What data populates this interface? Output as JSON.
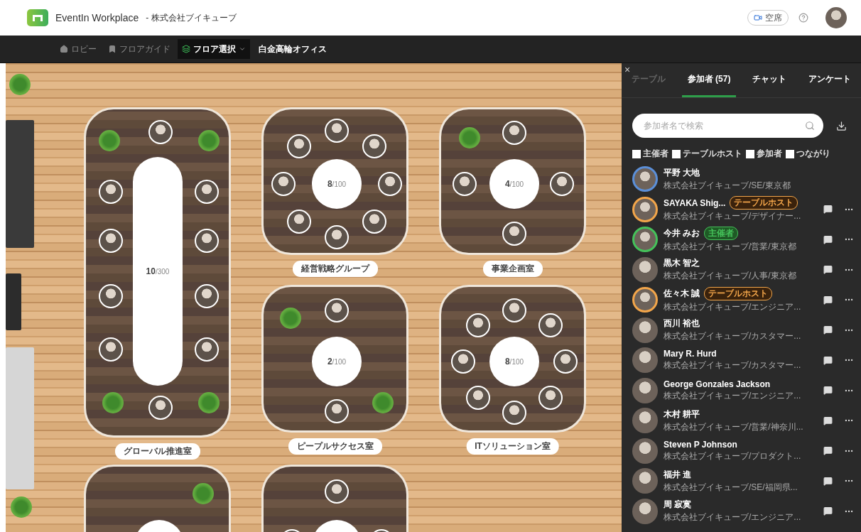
{
  "header": {
    "app_name": "EventIn Workplace",
    "org": "- 株式会社ブイキューブ",
    "status_button": "空席"
  },
  "nav": [
    {
      "kind": "home",
      "label": "ロビー",
      "selected": false
    },
    {
      "kind": "guide",
      "label": "フロアガイド",
      "selected": false
    },
    {
      "kind": "floor",
      "label": "フロア選択",
      "selected": true
    }
  ],
  "current_floor": "白金高輪オフィス",
  "rooms": [
    {
      "kind": "long",
      "label": "グローバル推進室",
      "count": "**10**/300"
    },
    {
      "kind": "round",
      "label": "経営戦略グループ",
      "count": "**8**/100"
    },
    {
      "kind": "round",
      "label": "事業企画室",
      "count": "**4**/100"
    },
    {
      "kind": "round",
      "label": "ピープルサクセス室",
      "count": "**2**/100"
    },
    {
      "kind": "round",
      "label": "ITソリューション室",
      "count": "**8**/100"
    },
    {
      "kind": "round"
    },
    {
      "kind": "round"
    }
  ],
  "panel": {
    "close": "×",
    "tabs": [
      {
        "label": "テーブル",
        "selected": false
      },
      {
        "label": "参加者 (57)",
        "selected": true
      },
      {
        "label": "チャット",
        "selected": false
      },
      {
        "label": "アンケート",
        "selected": false
      }
    ],
    "search": {
      "placeholder": "参加者名で検索"
    },
    "filters": [
      {
        "label": "主催者",
        "checked": false
      },
      {
        "label": "テーブルホスト",
        "checked": false
      },
      {
        "label": "参加者",
        "checked": false
      },
      {
        "label": "つながり",
        "checked": false
      }
    ],
    "participants": [
      {
        "name": "平野 大地",
        "detail": "株式会社ブイキューブ/SE/東京都",
        "self": true
      },
      {
        "name": "SAYAKA Shig...",
        "detail": "株式会社ブイキューブ/デザイナー...",
        "self": false,
        "badge": {
          "kind": "host",
          "label": "テーブルホスト"
        }
      },
      {
        "name": "今井 みお",
        "detail": "株式会社ブイキューブ/営業/東京都",
        "self": false,
        "badge": {
          "kind": "organizer",
          "label": "主催者"
        }
      },
      {
        "name": "黒木 智之",
        "detail": "株式会社ブイキューブ/人事/東京都",
        "self": false
      },
      {
        "name": "佐々木 誠",
        "detail": "株式会社ブイキューブ/エンジニア...",
        "self": false,
        "badge": {
          "kind": "host",
          "label": "テーブルホスト"
        }
      },
      {
        "name": "西川 裕也",
        "detail": "株式会社ブイキューブ/カスタマー...",
        "self": false
      },
      {
        "name": "Mary R. Hurd",
        "detail": "株式会社ブイキューブ/カスタマー...",
        "self": false
      },
      {
        "name": "George Gonzales Jackson",
        "detail": "株式会社ブイキューブ/エンジニア...",
        "self": false
      },
      {
        "name": "木村 耕平",
        "detail": "株式会社ブイキューブ/営業/神奈川...",
        "self": false
      },
      {
        "name": "Steven P Johnson",
        "detail": "株式会社ブイキューブ/プロダクト...",
        "self": false
      },
      {
        "name": "福井 進",
        "detail": "株式会社ブイキューブ/SE/福岡県...",
        "self": false
      },
      {
        "name": "周 寂寞",
        "detail": "株式会社ブイキューブ/エンジニア...",
        "self": false
      }
    ]
  }
}
